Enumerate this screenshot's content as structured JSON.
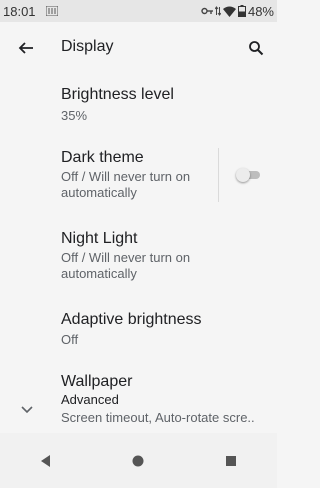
{
  "status_bar": {
    "time": "18:01",
    "battery": "48%",
    "icons": [
      "sim-notification-icon",
      "vpn-key-icon",
      "data-arrows-icon",
      "wifi-icon",
      "battery-icon"
    ]
  },
  "app_bar": {
    "title": "Display",
    "back_icon": "back-arrow-icon",
    "search_icon": "search-icon"
  },
  "settings": [
    {
      "title": "Brightness level",
      "summary": "35%"
    },
    {
      "title": "Dark theme",
      "summary": "Off / Will never turn on automatically",
      "toggle": false
    },
    {
      "title": "Night Light",
      "summary": "Off / Will never turn on automatically"
    },
    {
      "title": "Adaptive brightness",
      "summary": "Off"
    },
    {
      "title": "Wallpaper"
    },
    {
      "title": "Advanced",
      "summary": "Screen timeout, Auto-rotate scre..",
      "icon": "chevron-down-icon"
    }
  ],
  "nav_bar": {
    "buttons": [
      "back-triangle-icon",
      "home-circle-icon",
      "recents-square-icon"
    ]
  },
  "colors": {
    "background": "#f5f5f5",
    "status_bar": "#e6e6e6",
    "primary_text": "#202124",
    "secondary_text": "#5f6368"
  }
}
